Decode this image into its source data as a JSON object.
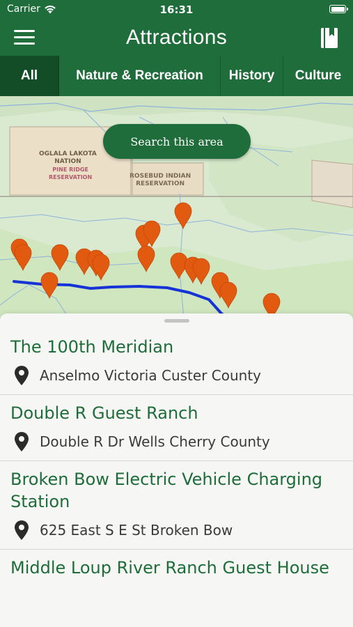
{
  "status_bar": {
    "carrier": "Carrier",
    "time": "16:31"
  },
  "nav": {
    "title": "Attractions",
    "left_icon": "menu-icon",
    "right_icon": "bookmark-book-icon"
  },
  "tabs": [
    {
      "label": "All",
      "active": true
    },
    {
      "label": "Nature & Recreation",
      "active": false
    },
    {
      "label": "History",
      "active": false
    },
    {
      "label": "Culture",
      "active": false
    }
  ],
  "map": {
    "search_button": "Search this area",
    "labels": {
      "oglala_line1": "OGLALA LAKOTA",
      "oglala_line2": "NATION",
      "pine_ridge_line1": "PINE RIDGE",
      "pine_ridge_line2": "RESERVATION",
      "rosebud_line1": "ROSEBUD INDIAN",
      "rosebud_line2": "RESERVATION"
    },
    "marker_color": "#e25a10",
    "route_color": "#1533d6"
  },
  "attractions": [
    {
      "name": "The 100th Meridian",
      "address": "Anselmo Victoria Custer County"
    },
    {
      "name": "Double R Guest Ranch",
      "address": "Double R Dr Wells Cherry County"
    },
    {
      "name": "Broken Bow Electric Vehicle Charging Station",
      "address": "625 East S E St Broken Bow"
    },
    {
      "name": "Middle Loup River Ranch Guest House",
      "address": ""
    }
  ],
  "colors": {
    "brand_green": "#1e6d3a",
    "tab_active": "#134d28"
  }
}
